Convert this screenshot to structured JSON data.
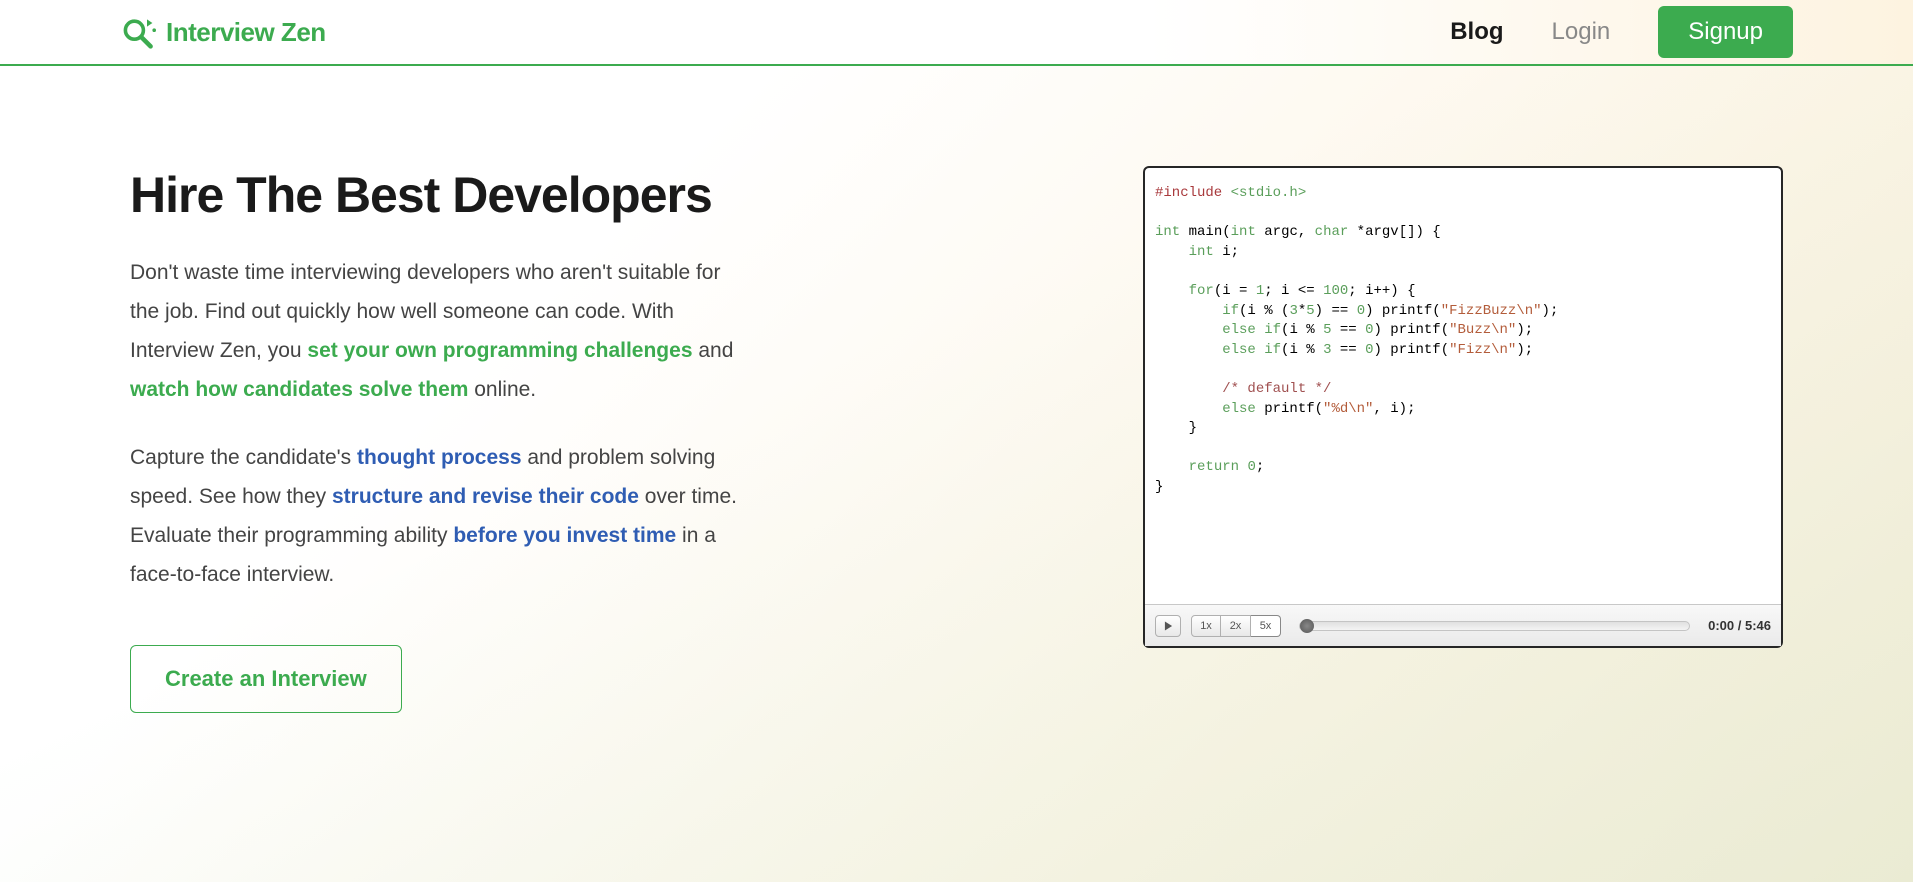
{
  "brand": "Interview Zen",
  "nav": {
    "blog": "Blog",
    "login": "Login",
    "signup": "Signup"
  },
  "hero": {
    "headline": "Hire The Best Developers",
    "p1a": "Don't waste time interviewing developers who aren't suitable for the job. Find out quickly how well someone can code. With Interview Zen, you ",
    "p1_green1": "set your own programming challenges",
    "p1b": " and ",
    "p1_green2": "watch how candidates solve them",
    "p1c": " online.",
    "p2a": "Capture the candidate's ",
    "p2_blue1": "thought process",
    "p2b": " and problem solving speed. See how they ",
    "p2_blue2": "structure and revise their code",
    "p2c": " over time. Evaluate their programming ability ",
    "p2_blue3": "before you invest time",
    "p2d": " in a face-to-face interview.",
    "cta": "Create an Interview"
  },
  "player": {
    "speeds": [
      "1x",
      "2x",
      "5x"
    ],
    "active_speed": "5x",
    "time": "0:00 / 5:46"
  },
  "code": {
    "l1a": "#include ",
    "l1b": "<stdio.h>",
    "l3a": "int",
    "l3b": " main(",
    "l3c": "int",
    "l3d": " argc, ",
    "l3e": "char",
    "l3f": " *argv[]) {",
    "l4a": "    ",
    "l4b": "int",
    "l4c": " i;",
    "l6a": "    ",
    "l6b": "for",
    "l6c": "(i = ",
    "l6d": "1",
    "l6e": "; i <= ",
    "l6f": "100",
    "l6g": "; i++) {",
    "l7a": "        ",
    "l7b": "if",
    "l7c": "(i % (",
    "l7d": "3",
    "l7e": "*",
    "l7f": "5",
    "l7g": ") == ",
    "l7h": "0",
    "l7i": ") printf(",
    "l7j": "\"FizzBuzz\\n\"",
    "l7k": ");",
    "l8a": "        ",
    "l8b": "else",
    "l8c": " ",
    "l8d": "if",
    "l8e": "(i % ",
    "l8f": "5",
    "l8g": " == ",
    "l8h": "0",
    "l8i": ") printf(",
    "l8j": "\"Buzz\\n\"",
    "l8k": ");",
    "l9a": "        ",
    "l9b": "else",
    "l9c": " ",
    "l9d": "if",
    "l9e": "(i % ",
    "l9f": "3",
    "l9g": " == ",
    "l9h": "0",
    "l9i": ") printf(",
    "l9j": "\"Fizz\\n\"",
    "l9k": ");",
    "l11a": "        ",
    "l11b": "/* default */",
    "l12a": "        ",
    "l12b": "else",
    "l12c": " printf(",
    "l12d": "\"%d\\n\"",
    "l12e": ", i);",
    "l13": "    }",
    "l15a": "    ",
    "l15b": "return",
    "l15c": " ",
    "l15d": "0",
    "l15e": ";",
    "l16": "}"
  }
}
